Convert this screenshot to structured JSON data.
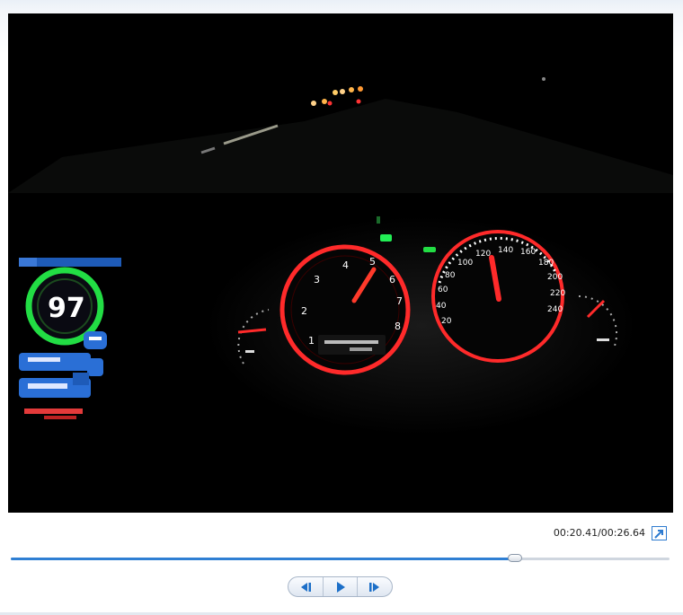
{
  "player": {
    "time_display": "00:20.41/00:26.64",
    "progress": 0.766
  },
  "video_frame": {
    "overlay_speed": "97",
    "tach_numbers": [
      "1",
      "2",
      "3",
      "4",
      "5",
      "6",
      "7",
      "8"
    ],
    "speedo_numbers": [
      "20",
      "40",
      "60",
      "80",
      "100",
      "120",
      "140",
      "160",
      "180",
      "200",
      "220",
      "240"
    ]
  },
  "controls": {
    "prev_icon": "skip-back-icon",
    "play_icon": "play-icon",
    "next_icon": "skip-forward-icon",
    "popout_icon": "popout-arrow-icon"
  },
  "colors": {
    "accent": "#2f7fd3",
    "gauge_red": "#ff2a2a",
    "overlay_green": "#22dd44",
    "overlay_blue": "#2a6fd6"
  }
}
